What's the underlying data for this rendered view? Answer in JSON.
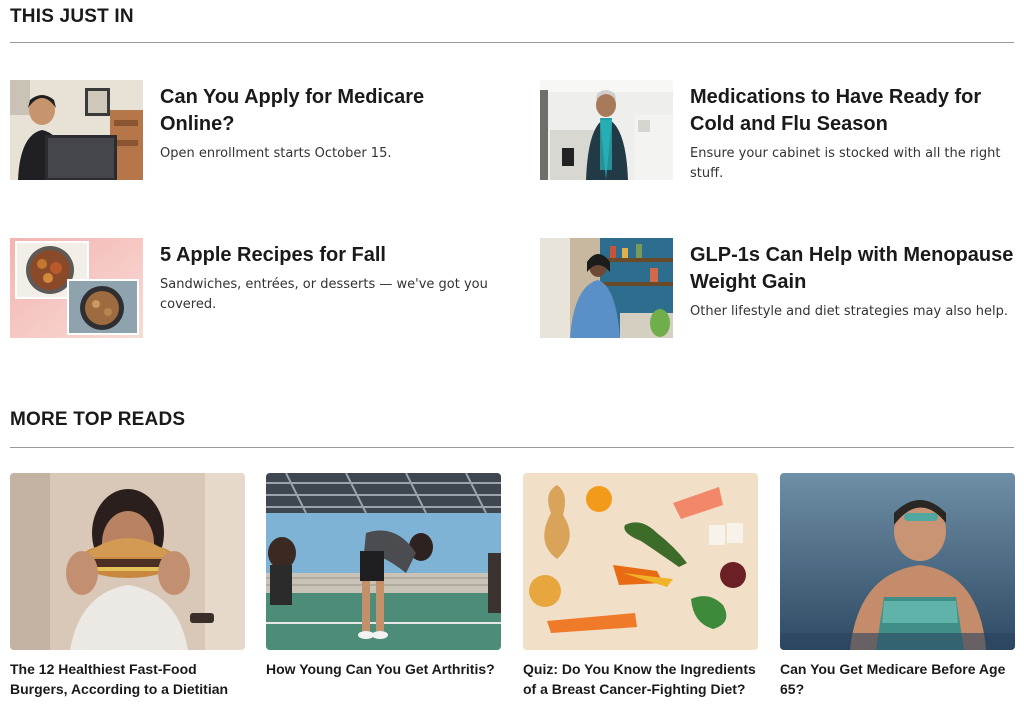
{
  "sections": {
    "just_in_title": "THIS JUST IN",
    "more_reads_title": "MORE TOP READS"
  },
  "just_in": [
    {
      "headline": "Can You Apply for Medicare Online?",
      "dek": "Open enrollment starts October 15."
    },
    {
      "headline": "Medications to Have Ready for Cold and Flu Season",
      "dek": "Ensure your cabinet is stocked with all the right stuff."
    },
    {
      "headline": "5 Apple Recipes for Fall",
      "dek": "Sandwiches, entrées, or desserts — we've got you covered."
    },
    {
      "headline": "GLP-1s Can Help with Menopause Weight Gain",
      "dek": "Other lifestyle and diet strategies may also help."
    }
  ],
  "top_reads": [
    {
      "title": "The 12 Healthiest Fast-Food Burgers, According to a Dietitian"
    },
    {
      "title": "How Young Can You Get Arthritis?"
    },
    {
      "title": "Quiz: Do You Know the Ingredients of a Breast Cancer-Fighting Diet?"
    },
    {
      "title": "Can You Get Medicare Before Age 65?"
    }
  ],
  "colors": {
    "rule": "#9a9a9a",
    "text": "#1a1a1a"
  }
}
